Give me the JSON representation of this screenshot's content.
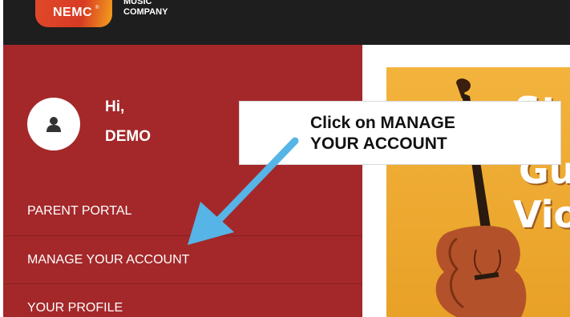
{
  "header": {
    "logo_badge": "NEMC",
    "logo_reg": "®",
    "logo_line1": "MUSIC",
    "logo_line2": "COMPANY"
  },
  "user": {
    "greeting": "Hi,",
    "name": "DEMO",
    "avatar_icon": "user-icon"
  },
  "nav": {
    "items": [
      {
        "label": "PARENT PORTAL"
      },
      {
        "label": "MANAGE YOUR ACCOUNT"
      },
      {
        "label": "YOUR PROFILE"
      }
    ]
  },
  "callout": {
    "line1": "Click on MANAGE",
    "line2": "YOUR ACCOUNT"
  },
  "banner": {
    "word1": "St",
    "word2": "Gu",
    "word3": "Vio",
    "image_icon": "violin-icon"
  },
  "colors": {
    "sidebar": "#a4282a",
    "topbar": "#1e1e1e",
    "arrow": "#56b4e6",
    "banner": "#f2b33d"
  }
}
